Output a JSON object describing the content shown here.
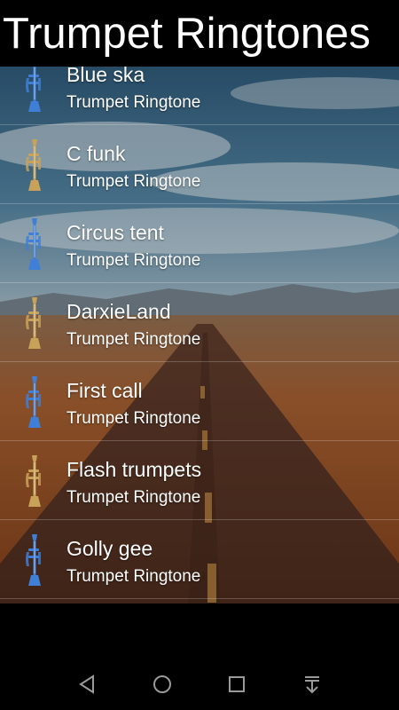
{
  "app": {
    "title": "Trumpet Ringtones"
  },
  "list": {
    "items": [
      {
        "name": "Blue ska",
        "subtitle": "Trumpet Ringtone",
        "icon": "trumpet-blue-icon"
      },
      {
        "name": "C funk",
        "subtitle": "Trumpet Ringtone",
        "icon": "trumpet-gold-icon"
      },
      {
        "name": "Circus tent",
        "subtitle": "Trumpet Ringtone",
        "icon": "trumpet-blue-icon"
      },
      {
        "name": "DarxieLand",
        "subtitle": "Trumpet Ringtone",
        "icon": "trumpet-gold-icon"
      },
      {
        "name": "First call",
        "subtitle": "Trumpet Ringtone",
        "icon": "trumpet-blue-icon"
      },
      {
        "name": "Flash trumpets",
        "subtitle": "Trumpet Ringtone",
        "icon": "trumpet-gold-icon"
      },
      {
        "name": "Golly gee",
        "subtitle": "Trumpet Ringtone",
        "icon": "trumpet-blue-icon"
      }
    ]
  },
  "navbar": {
    "buttons": [
      "back-icon",
      "home-icon",
      "recents-icon",
      "notification-pull-icon"
    ]
  },
  "colors": {
    "header_bg": "#000000",
    "text": "#ffffff",
    "trumpet_blue": "#3f7fd8",
    "trumpet_gold": "#c9a25a"
  }
}
